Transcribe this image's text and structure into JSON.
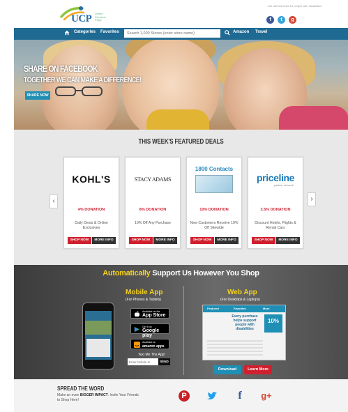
{
  "header": {
    "logo_text": "UCP",
    "logo_tag": "United Cerebral Palsy",
    "tagline": "Life without limits for people with disabilities",
    "social": [
      "facebook-icon",
      "twitter-icon",
      "googleplus-icon"
    ]
  },
  "nav": {
    "categories": "Categories",
    "favorites": "Favorites",
    "search_placeholder": "Search 1,000 Stores (enter store name)",
    "amazon": "Amazon",
    "travel": "Travel"
  },
  "hero": {
    "line1": "SHARE ON FACEBOOK",
    "line2": "TOGETHER WE CAN MAKE A DIFFERENCE!",
    "button": "SHARE NOW"
  },
  "deals": {
    "title": "THIS WEEK'S FEATURED DEALS",
    "prev": "‹",
    "next": "›",
    "cards": [
      {
        "store": "KOHL'S",
        "donation": "4% DONATION",
        "description": "Daily Deals & Online Exclusives",
        "shop": "SHOP NOW",
        "more": "MORE INFO"
      },
      {
        "store": "STACY ADAMS",
        "donation": "8% DONATION",
        "description": "10% Off Any Purchase",
        "shop": "SHOP NOW",
        "more": "MORE INFO"
      },
      {
        "store": "1800 Contacts",
        "donation": "10% DONATION",
        "description": "New Customers Receive 10% Off Sitewide",
        "shop": "SHOP NOW",
        "more": "MORE INFO"
      },
      {
        "store": "priceline",
        "store_sub": "partner network",
        "donation": "3.5% DONATION",
        "description": "Discount Hotels, Flights & Rental Cars",
        "shop": "SHOP NOW",
        "more": "MORE INFO"
      }
    ]
  },
  "apps": {
    "headline_a": "Automatically",
    "headline_b": "Support Us However You Shop",
    "mobile_title": "Mobile App",
    "mobile_sub": "(For Phones & Tablets)",
    "appstore_small": "Available on the",
    "appstore_big": "App Store",
    "google_small": "Get it on",
    "google_big": "Google play",
    "amazon_small": "Available at",
    "amazon_big": "amazon apps",
    "textme": "Text Me The App!",
    "mobile_placeholder": "Enter Mobile N",
    "send": "SEND",
    "web_title": "Web App",
    "web_sub": "(For Desktops & Laptops)",
    "web_tab1": "Featured",
    "web_tab2": "Favorites",
    "web_tab3": "More",
    "web_msg": "Every purchase helps support people with disabilities",
    "web_pct": "10%",
    "download": "Download",
    "learn": "Learn More"
  },
  "spread": {
    "title": "SPREAD THE WORD",
    "desc_a": "Make an even ",
    "desc_b": "BIGGER IMPACT",
    "desc_c": ". Invite Your Friends to Shop Here!",
    "icons": [
      "pinterest-icon",
      "twitter-icon",
      "facebook-icon",
      "googleplus-icon"
    ]
  },
  "colors": {
    "nav": "#1f6a93",
    "accent_red": "#d0202e",
    "accent_yellow": "#f5d21a",
    "accent_blue": "#1f8fb5"
  }
}
